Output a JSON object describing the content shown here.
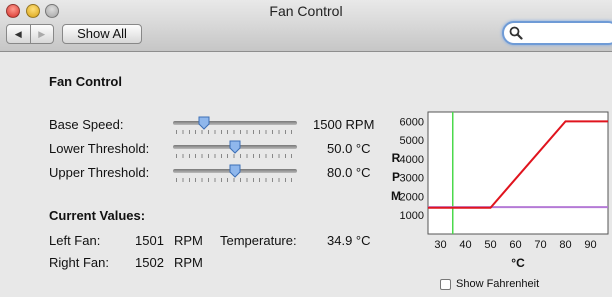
{
  "window": {
    "title": "Fan Control"
  },
  "toolbar": {
    "show_all": "Show All",
    "back": "◀",
    "forward": "▶",
    "search_value": ""
  },
  "section_title": "Fan Control",
  "sliders": [
    {
      "label": "Base Speed:",
      "value": "1500 RPM",
      "position": 0.22
    },
    {
      "label": "Lower Threshold:",
      "value": "50.0 °C",
      "position": 0.5
    },
    {
      "label": "Upper Threshold:",
      "value": "80.0 °C",
      "position": 0.5
    }
  ],
  "current": {
    "title": "Current Values:",
    "left_label": "Left Fan:",
    "left_value": "1501",
    "left_unit": "RPM",
    "right_label": "Right Fan:",
    "right_value": "1502",
    "right_unit": "RPM",
    "temp_label": "Temperature:",
    "temp_value": "34.9 °C"
  },
  "show_fahrenheit": {
    "label": "Show Fahrenheit",
    "checked": false
  },
  "chart_data": {
    "type": "line",
    "xlabel": "°C",
    "ylabel": "RPM",
    "ylabel_letters": [
      "R",
      "P",
      "M"
    ],
    "xlim": [
      25,
      97
    ],
    "ylim": [
      0,
      6500
    ],
    "x_ticks": [
      30,
      40,
      50,
      60,
      70,
      80,
      90
    ],
    "y_ticks": [
      1000,
      2000,
      3000,
      4000,
      5000,
      6000
    ],
    "series": [
      {
        "color": "#e0141e",
        "x": [
          25,
          50,
          80,
          97
        ],
        "y": [
          1400,
          1400,
          6000,
          6000
        ]
      },
      {
        "color": "#b47ad6",
        "x": [
          25,
          97
        ],
        "y": [
          1430,
          1430
        ]
      }
    ],
    "marker_x": 34.9,
    "marker_color": "#4cd94c"
  }
}
